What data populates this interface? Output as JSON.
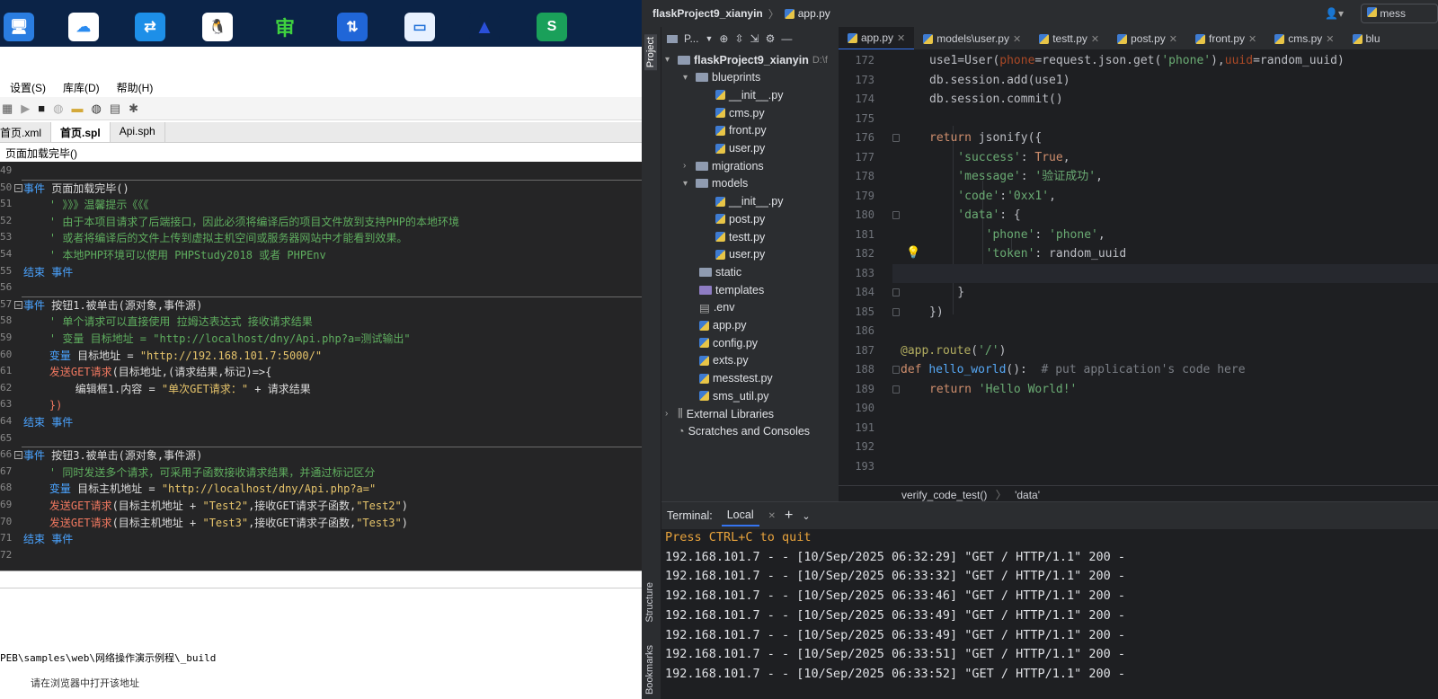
{
  "left_ide": {
    "menu": [
      "设置(S)",
      "库库(D)",
      "帮助(H)"
    ],
    "tabs": [
      "首页.xml",
      "首页.spl",
      "Api.sph"
    ],
    "active_tab": "首页.spl",
    "breadcrumb": "页面加载完毕()",
    "bottom_path": "PEB\\samples\\web\\网络操作演示例程\\_build",
    "bottom_hint": "请在浏览器中打开该地址",
    "code": [
      {
        "n": "49",
        "segs": []
      },
      {
        "n": "50",
        "segs": [
          {
            "c": "kw",
            "t": "事件 "
          },
          {
            "c": "tx",
            "t": "页面加载完毕()"
          }
        ]
      },
      {
        "n": "51",
        "segs": [
          {
            "c": "cm",
            "t": "    ' 》》》温馨提示《《《"
          }
        ]
      },
      {
        "n": "52",
        "segs": [
          {
            "c": "cm",
            "t": "    ' 由于本项目请求了后端接口，因此必须将编译后的项目文件放到支持PHP的本地环境"
          }
        ]
      },
      {
        "n": "53",
        "segs": [
          {
            "c": "cm",
            "t": "    ' 或者将编译后的文件上传到虚拟主机空间或服务器网站中才能看到效果。"
          }
        ]
      },
      {
        "n": "54",
        "segs": [
          {
            "c": "cm",
            "t": "    ' 本地PHP环境可以使用 PHPStudy2018 或者 PHPEnv"
          }
        ]
      },
      {
        "n": "55",
        "segs": [
          {
            "c": "kw",
            "t": "结束 事件"
          }
        ]
      },
      {
        "n": "56",
        "segs": []
      },
      {
        "n": "57",
        "segs": [
          {
            "c": "kw",
            "t": "事件 "
          },
          {
            "c": "tx",
            "t": "按钮1.被单击(源对象,事件源)"
          }
        ]
      },
      {
        "n": "58",
        "segs": [
          {
            "c": "cm",
            "t": "    ' 单个请求可以直接使用 拉姆达表达式 接收请求结果"
          }
        ]
      },
      {
        "n": "59",
        "segs": [
          {
            "c": "cm",
            "t": "    ' 变量 目标地址 = \"http://localhost/dny/Api.php?a=测试输出\""
          }
        ]
      },
      {
        "n": "60",
        "segs": [
          {
            "c": "kw",
            "t": "    变量 "
          },
          {
            "c": "tx",
            "t": "目标地址 = "
          },
          {
            "c": "st",
            "t": "\"http://192.168.101.7:5000/\""
          }
        ]
      },
      {
        "n": "61",
        "segs": [
          {
            "c": "fn",
            "t": "    发送GET请求"
          },
          {
            "c": "tx",
            "t": "(目标地址,(请求结果,标记)=>{"
          }
        ]
      },
      {
        "n": "62",
        "segs": [
          {
            "c": "tx",
            "t": "        编辑框1.内容 = "
          },
          {
            "c": "st",
            "t": "\"单次GET请求：\""
          },
          {
            "c": "tx",
            "t": " + 请求结果"
          }
        ]
      },
      {
        "n": "63",
        "segs": [
          {
            "c": "fn",
            "t": "    })"
          }
        ]
      },
      {
        "n": "64",
        "segs": [
          {
            "c": "kw",
            "t": "结束 事件"
          }
        ]
      },
      {
        "n": "65",
        "segs": []
      },
      {
        "n": "66",
        "segs": [
          {
            "c": "kw",
            "t": "事件 "
          },
          {
            "c": "tx",
            "t": "按钮3.被单击(源对象,事件源)"
          }
        ]
      },
      {
        "n": "67",
        "segs": [
          {
            "c": "cm",
            "t": "    ' 同时发送多个请求，可采用子函数接收请求结果，并通过标记区分"
          }
        ]
      },
      {
        "n": "68",
        "segs": [
          {
            "c": "kw",
            "t": "    变量 "
          },
          {
            "c": "tx",
            "t": "目标主机地址 = "
          },
          {
            "c": "st",
            "t": "\"http://localhost/dny/Api.php?a=\""
          }
        ]
      },
      {
        "n": "69",
        "segs": [
          {
            "c": "fn",
            "t": "    发送GET请求"
          },
          {
            "c": "tx",
            "t": "(目标主机地址 + "
          },
          {
            "c": "st",
            "t": "\"Test2\""
          },
          {
            "c": "tx",
            "t": ",接收GET请求子函数,"
          },
          {
            "c": "st",
            "t": "\"Test2\""
          },
          {
            "c": "tx",
            "t": ")"
          }
        ]
      },
      {
        "n": "70",
        "segs": [
          {
            "c": "fn",
            "t": "    发送GET请求"
          },
          {
            "c": "tx",
            "t": "(目标主机地址 + "
          },
          {
            "c": "st",
            "t": "\"Test3\""
          },
          {
            "c": "tx",
            "t": ",接收GET请求子函数,"
          },
          {
            "c": "st",
            "t": "\"Test3\""
          },
          {
            "c": "tx",
            "t": ")"
          }
        ]
      },
      {
        "n": "71",
        "segs": [
          {
            "c": "kw",
            "t": "结束 事件"
          }
        ]
      },
      {
        "n": "72",
        "segs": []
      }
    ]
  },
  "pycharm": {
    "project_name": "flaskProject9_xianyin",
    "current_file": "app.py",
    "side_labels": [
      "Project",
      "Structure",
      "Bookmarks"
    ],
    "project_label": "P...",
    "project_path_hint": "D:\\f",
    "editor_tabs": [
      "app.py",
      "models\\user.py",
      "testt.py",
      "post.py",
      "front.py",
      "cms.py",
      "blu"
    ],
    "active_editor_tab": "app.py",
    "tree": [
      {
        "label": "flaskProject9_xianyin",
        "kind": "root"
      },
      {
        "label": "blueprints",
        "kind": "open"
      },
      {
        "label": "__init__.py",
        "kind": "file2"
      },
      {
        "label": "cms.py",
        "kind": "file2"
      },
      {
        "label": "front.py",
        "kind": "file2"
      },
      {
        "label": "user.py",
        "kind": "file2"
      },
      {
        "label": "migrations",
        "kind": "closed"
      },
      {
        "label": "models",
        "kind": "open"
      },
      {
        "label": "__init__.py",
        "kind": "file2"
      },
      {
        "label": "post.py",
        "kind": "file2"
      },
      {
        "label": "testt.py",
        "kind": "file2"
      },
      {
        "label": "user.py",
        "kind": "file2"
      },
      {
        "label": "static",
        "kind": "folder1"
      },
      {
        "label": "templates",
        "kind": "folder1p"
      },
      {
        "label": ".env",
        "kind": "file1"
      },
      {
        "label": "app.py",
        "kind": "file1"
      },
      {
        "label": "config.py",
        "kind": "file1"
      },
      {
        "label": "exts.py",
        "kind": "file1"
      },
      {
        "label": "messtest.py",
        "kind": "file1"
      },
      {
        "label": "sms_util.py",
        "kind": "file1"
      },
      {
        "label": "External Libraries",
        "kind": "closed0"
      },
      {
        "label": "Scratches and Consoles",
        "kind": "leaf0"
      }
    ],
    "editor_lines": [
      {
        "n": "172",
        "segs": [
          {
            "c": "",
            "t": "use1=User("
          },
          {
            "c": "p",
            "t": "phone"
          },
          {
            "c": "",
            "t": "=request.json.get("
          },
          {
            "c": "s",
            "t": "'phone'"
          },
          {
            "c": "",
            "t": "),"
          },
          {
            "c": "p",
            "t": "uuid"
          },
          {
            "c": "",
            "t": "=random_uuid)"
          }
        ]
      },
      {
        "n": "173",
        "segs": [
          {
            "c": "",
            "t": "db.session.add(use1)"
          }
        ]
      },
      {
        "n": "174",
        "segs": [
          {
            "c": "",
            "t": "db.session.commit()"
          }
        ]
      },
      {
        "n": "175",
        "segs": []
      },
      {
        "n": "176",
        "segs": [
          {
            "c": "k",
            "t": "return "
          },
          {
            "c": "",
            "t": "jsonify({"
          }
        ]
      },
      {
        "n": "177",
        "segs": [
          {
            "c": "s",
            "t": "    'success'"
          },
          {
            "c": "",
            "t": ": "
          },
          {
            "c": "k",
            "t": "True"
          },
          {
            "c": "",
            "t": ","
          }
        ]
      },
      {
        "n": "178",
        "segs": [
          {
            "c": "s",
            "t": "    'message'"
          },
          {
            "c": "",
            "t": ": "
          },
          {
            "c": "s",
            "t": "'验证成功'"
          },
          {
            "c": "",
            "t": ","
          }
        ]
      },
      {
        "n": "179",
        "segs": [
          {
            "c": "s",
            "t": "    'code'"
          },
          {
            "c": "",
            "t": ":"
          },
          {
            "c": "s",
            "t": "'0xx1'"
          },
          {
            "c": "",
            "t": ","
          }
        ]
      },
      {
        "n": "180",
        "segs": [
          {
            "c": "s",
            "t": "    'data'"
          },
          {
            "c": "",
            "t": ": {"
          }
        ]
      },
      {
        "n": "181",
        "segs": [
          {
            "c": "s",
            "t": "        'phone'"
          },
          {
            "c": "",
            "t": ": "
          },
          {
            "c": "s",
            "t": "'phone'"
          },
          {
            "c": "",
            "t": ","
          }
        ]
      },
      {
        "n": "182",
        "segs": [
          {
            "c": "s",
            "t": "        'token'"
          },
          {
            "c": "",
            "t": ": random_uuid"
          }
        ]
      },
      {
        "n": "183",
        "segs": []
      },
      {
        "n": "184",
        "segs": [
          {
            "c": "",
            "t": "    }"
          }
        ]
      },
      {
        "n": "185",
        "segs": [
          {
            "c": "",
            "t": "})"
          }
        ]
      },
      {
        "n": "186",
        "segs": []
      },
      {
        "n": "187",
        "segs": [
          {
            "c": "d",
            "t": "@app.route"
          },
          {
            "c": "",
            "t": "("
          },
          {
            "c": "s",
            "t": "'/'"
          },
          {
            "c": "",
            "t": ")"
          }
        ],
        "outdent": true
      },
      {
        "n": "188",
        "segs": [
          {
            "c": "k",
            "t": "def "
          },
          {
            "c": "f",
            "t": "hello_world"
          },
          {
            "c": "",
            "t": "():  "
          },
          {
            "c": "c",
            "t": "# put application's code here"
          }
        ],
        "outdent": true
      },
      {
        "n": "189",
        "segs": [
          {
            "c": "k",
            "t": "return "
          },
          {
            "c": "s",
            "t": "'Hello World!'"
          }
        ]
      },
      {
        "n": "190",
        "segs": []
      },
      {
        "n": "191",
        "segs": []
      },
      {
        "n": "192",
        "segs": []
      },
      {
        "n": "193",
        "segs": []
      }
    ],
    "editor_breadcrumb": [
      "verify_code_test()",
      "'data'"
    ],
    "terminal": {
      "label": "Terminal:",
      "tab": "Local",
      "lines": [
        "Press CTRL+C to quit",
        "192.168.101.7 - - [10/Sep/2025 06:32:29] \"GET / HTTP/1.1\" 200 -",
        "192.168.101.7 - - [10/Sep/2025 06:33:32] \"GET / HTTP/1.1\" 200 -",
        "192.168.101.7 - - [10/Sep/2025 06:33:46] \"GET / HTTP/1.1\" 200 -",
        "192.168.101.7 - - [10/Sep/2025 06:33:49] \"GET / HTTP/1.1\" 200 -",
        "192.168.101.7 - - [10/Sep/2025 06:33:49] \"GET / HTTP/1.1\" 200 -",
        "192.168.101.7 - - [10/Sep/2025 06:33:51] \"GET / HTTP/1.1\" 200 -",
        "192.168.101.7 - - [10/Sep/2025 06:33:52] \"GET / HTTP/1.1\" 200 -"
      ]
    },
    "title_right": "mess"
  }
}
